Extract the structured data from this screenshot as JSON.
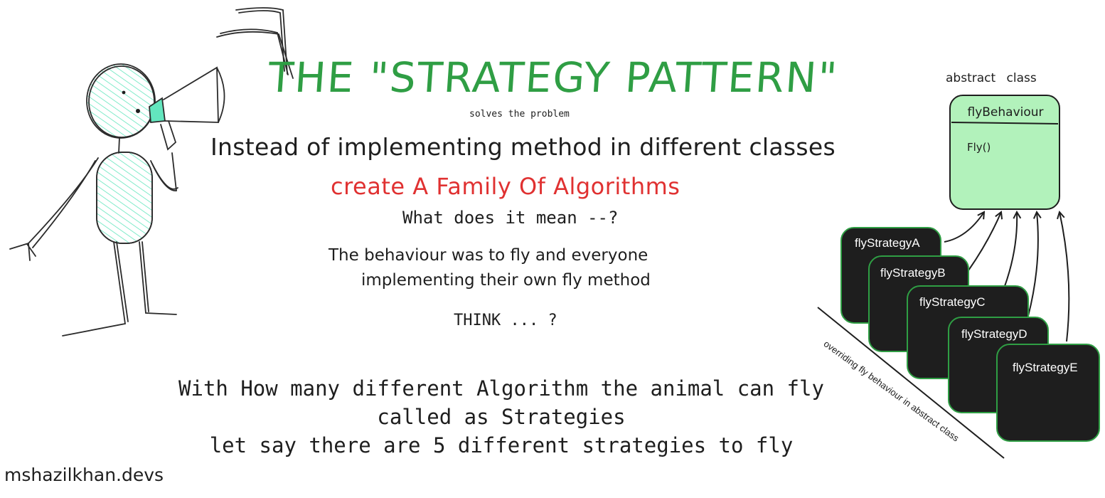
{
  "header": {
    "title": "THE \"STRATEGY PATTERN\"",
    "subtitle": "solves the problem"
  },
  "body": {
    "instead": "Instead of implementing method in different classes",
    "family": "create A Family Of Algorithms",
    "question": "What does it mean --?",
    "behaviour_line1": "The behaviour was to fly and everyone",
    "behaviour_line2": "implementing their own fly method",
    "think": "THINK ... ?",
    "bottom_text": "With How many different Algorithm the animal can fly\ncalled as Strategies\nlet say there are 5 different strategies to fly"
  },
  "diagram": {
    "abstract_label": "abstract class",
    "class_name": "flyBehaviour",
    "method": "Fly()",
    "strategies": [
      "flyStrategyA",
      "flyStrategyB",
      "flyStrategyC",
      "flyStrategyD",
      "flyStrategyE"
    ],
    "override_label": "overriding fly behaviour in abstract class"
  },
  "footer": {
    "watermark": "mshazilkhan.devs"
  },
  "colors": {
    "title_green": "#2f9e44",
    "accent_red": "#e03131",
    "box_fill": "#b2f2bb",
    "card_fill": "#1e1e1e",
    "card_border": "#2f9e44",
    "figure_fill": "#63e6be"
  }
}
